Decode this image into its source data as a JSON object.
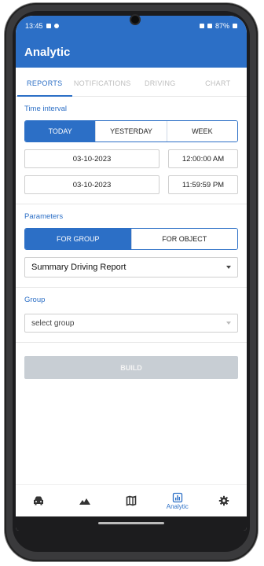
{
  "status_bar": {
    "time": "13:45",
    "battery": "87%"
  },
  "app_bar": {
    "title": "Analytic"
  },
  "tabs": [
    {
      "label": "REPORTS",
      "active": true
    },
    {
      "label": "NOTIFICATIONS",
      "active": false
    },
    {
      "label": "DRIVING",
      "active": false
    },
    {
      "label": "CHART",
      "active": false
    }
  ],
  "time_interval": {
    "label": "Time interval",
    "options": [
      "TODAY",
      "YESTERDAY",
      "WEEK"
    ],
    "selected": "TODAY",
    "from_date": "03-10-2023",
    "from_time": "12:00:00 AM",
    "to_date": "03-10-2023",
    "to_time": "11:59:59 PM"
  },
  "parameters": {
    "label": "Parameters",
    "options": [
      "FOR GROUP",
      "FOR OBJECT"
    ],
    "selected": "FOR GROUP",
    "report_type": "Summary Driving Report"
  },
  "group": {
    "label": "Group",
    "placeholder": "select group"
  },
  "build_button": {
    "label": "BUILD",
    "enabled": false
  },
  "bottom_nav": [
    {
      "icon": "car-icon",
      "label": "",
      "active": false
    },
    {
      "icon": "mountain-icon",
      "label": "",
      "active": false
    },
    {
      "icon": "map-icon",
      "label": "",
      "active": false
    },
    {
      "icon": "analytics-icon",
      "label": "Analytic",
      "active": true
    },
    {
      "icon": "gear-icon",
      "label": "",
      "active": false
    }
  ],
  "colors": {
    "primary": "#2c6fc6",
    "disabled": "#c8ced4"
  }
}
